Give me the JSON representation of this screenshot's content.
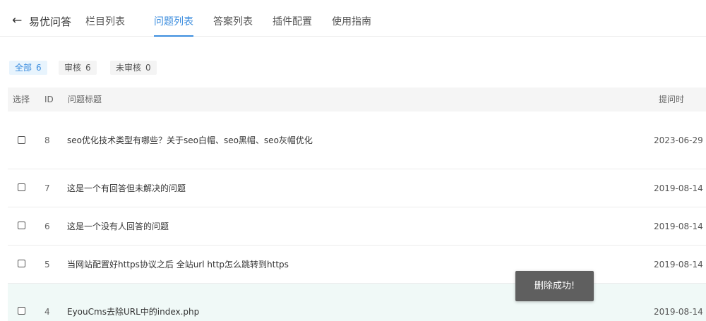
{
  "header": {
    "back_icon": "←",
    "app_title": "易优问答",
    "tabs": [
      {
        "label": "栏目列表",
        "active": false
      },
      {
        "label": "问题列表",
        "active": true
      },
      {
        "label": "答案列表",
        "active": false
      },
      {
        "label": "插件配置",
        "active": false
      },
      {
        "label": "使用指南",
        "active": false
      }
    ]
  },
  "filters": {
    "all": {
      "label": "全部",
      "count": "6"
    },
    "reviewed": {
      "label": "审核",
      "count": "6"
    },
    "unreviewed": {
      "label": "未审核",
      "count": "0"
    }
  },
  "table": {
    "headers": {
      "select": "选择",
      "id": "ID",
      "title": "问题标题",
      "time": "提问时"
    },
    "rows": [
      {
        "id": "8",
        "title": "seo优化技术类型有哪些？关于seo白帽、seo黑帽、seo灰帽优化",
        "date": "2023-06-29"
      },
      {
        "id": "7",
        "title": "这是一个有回答但未解决的问题",
        "date": "2019-08-14"
      },
      {
        "id": "6",
        "title": "这是一个没有人回答的问题",
        "date": "2019-08-14"
      },
      {
        "id": "5",
        "title": "当网站配置好https协议之后 全站url http怎么跳转到https",
        "date": "2019-08-14"
      },
      {
        "id": "4",
        "title": "EyouCms去除URL中的index.php",
        "date": "2019-08-14"
      }
    ]
  },
  "toast": {
    "message": "删除成功!"
  },
  "colors": {
    "accent": "#3c8dde",
    "row_highlight": "#f0f9f7",
    "toast_bg": "#5f5f5f"
  }
}
